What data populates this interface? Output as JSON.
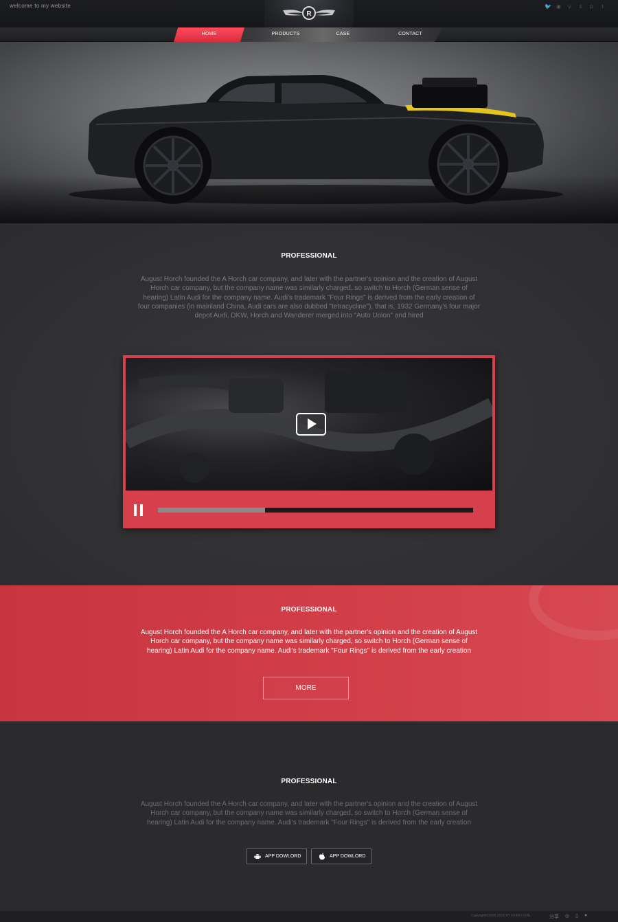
{
  "header": {
    "welcome": "welcome to  my  website",
    "social_icons": [
      "twitter-icon",
      "rss-icon",
      "vimeo-icon",
      "skype-icon",
      "pinterest-icon",
      "tumblr-icon"
    ]
  },
  "nav": {
    "items": [
      {
        "label": "HOME",
        "active": true
      },
      {
        "label": "PRODUCTS",
        "active": false
      },
      {
        "label": "CASE",
        "active": false
      },
      {
        "label": "CONTACT",
        "active": false
      }
    ]
  },
  "section1": {
    "title": "PROFESSIONAL",
    "body": "August Horch founded the A Horch car company, and later with the partner's opinion and the creation of August Horch car company, but the company name was similarly charged, so switch to Horch (German sense of hearing) Latin Audi for the company name. Audi's trademark \"Four Rings\" is derived from the early creation of four companies (in mainland China, Audi cars are also dubbed \"tetracycline\"), that is, 1932 Germany's four major depot Audi, DKW, Horch and Wanderer merged into \"Auto Union\" and hired"
  },
  "video": {
    "progress": 0.34
  },
  "section2": {
    "title": "PROFESSIONAL",
    "body": "August Horch founded the A Horch car company, and later with the partner's opinion and the creation of August Horch car company, but the company name was similarly charged, so switch to Horch (German sense of hearing) Latin Audi for the company name. Audi's trademark \"Four Rings\" is derived from the early creation",
    "button": "MORE"
  },
  "section3": {
    "title": "PROFESSIONAL",
    "body": "August Horch founded the A Horch car company, and later with the partner's opinion and the creation of August Horch car company, but the company name was similarly charged, so switch to Horch (German sense of hearing) Latin Audi for the company name. Audi's trademark \"Four Rings\" is derived from the early creation",
    "buttons": [
      {
        "label": "APP DOWLORD",
        "icon": "android-icon"
      },
      {
        "label": "APP DOWLORD",
        "icon": "apple-icon"
      }
    ]
  },
  "footer": {
    "copyright": "Copyright©2008-2015 BY FEIFEI GIRL",
    "share_label": "分享"
  },
  "colors": {
    "accent": "#d6404c",
    "background": "#2b2b2d"
  }
}
